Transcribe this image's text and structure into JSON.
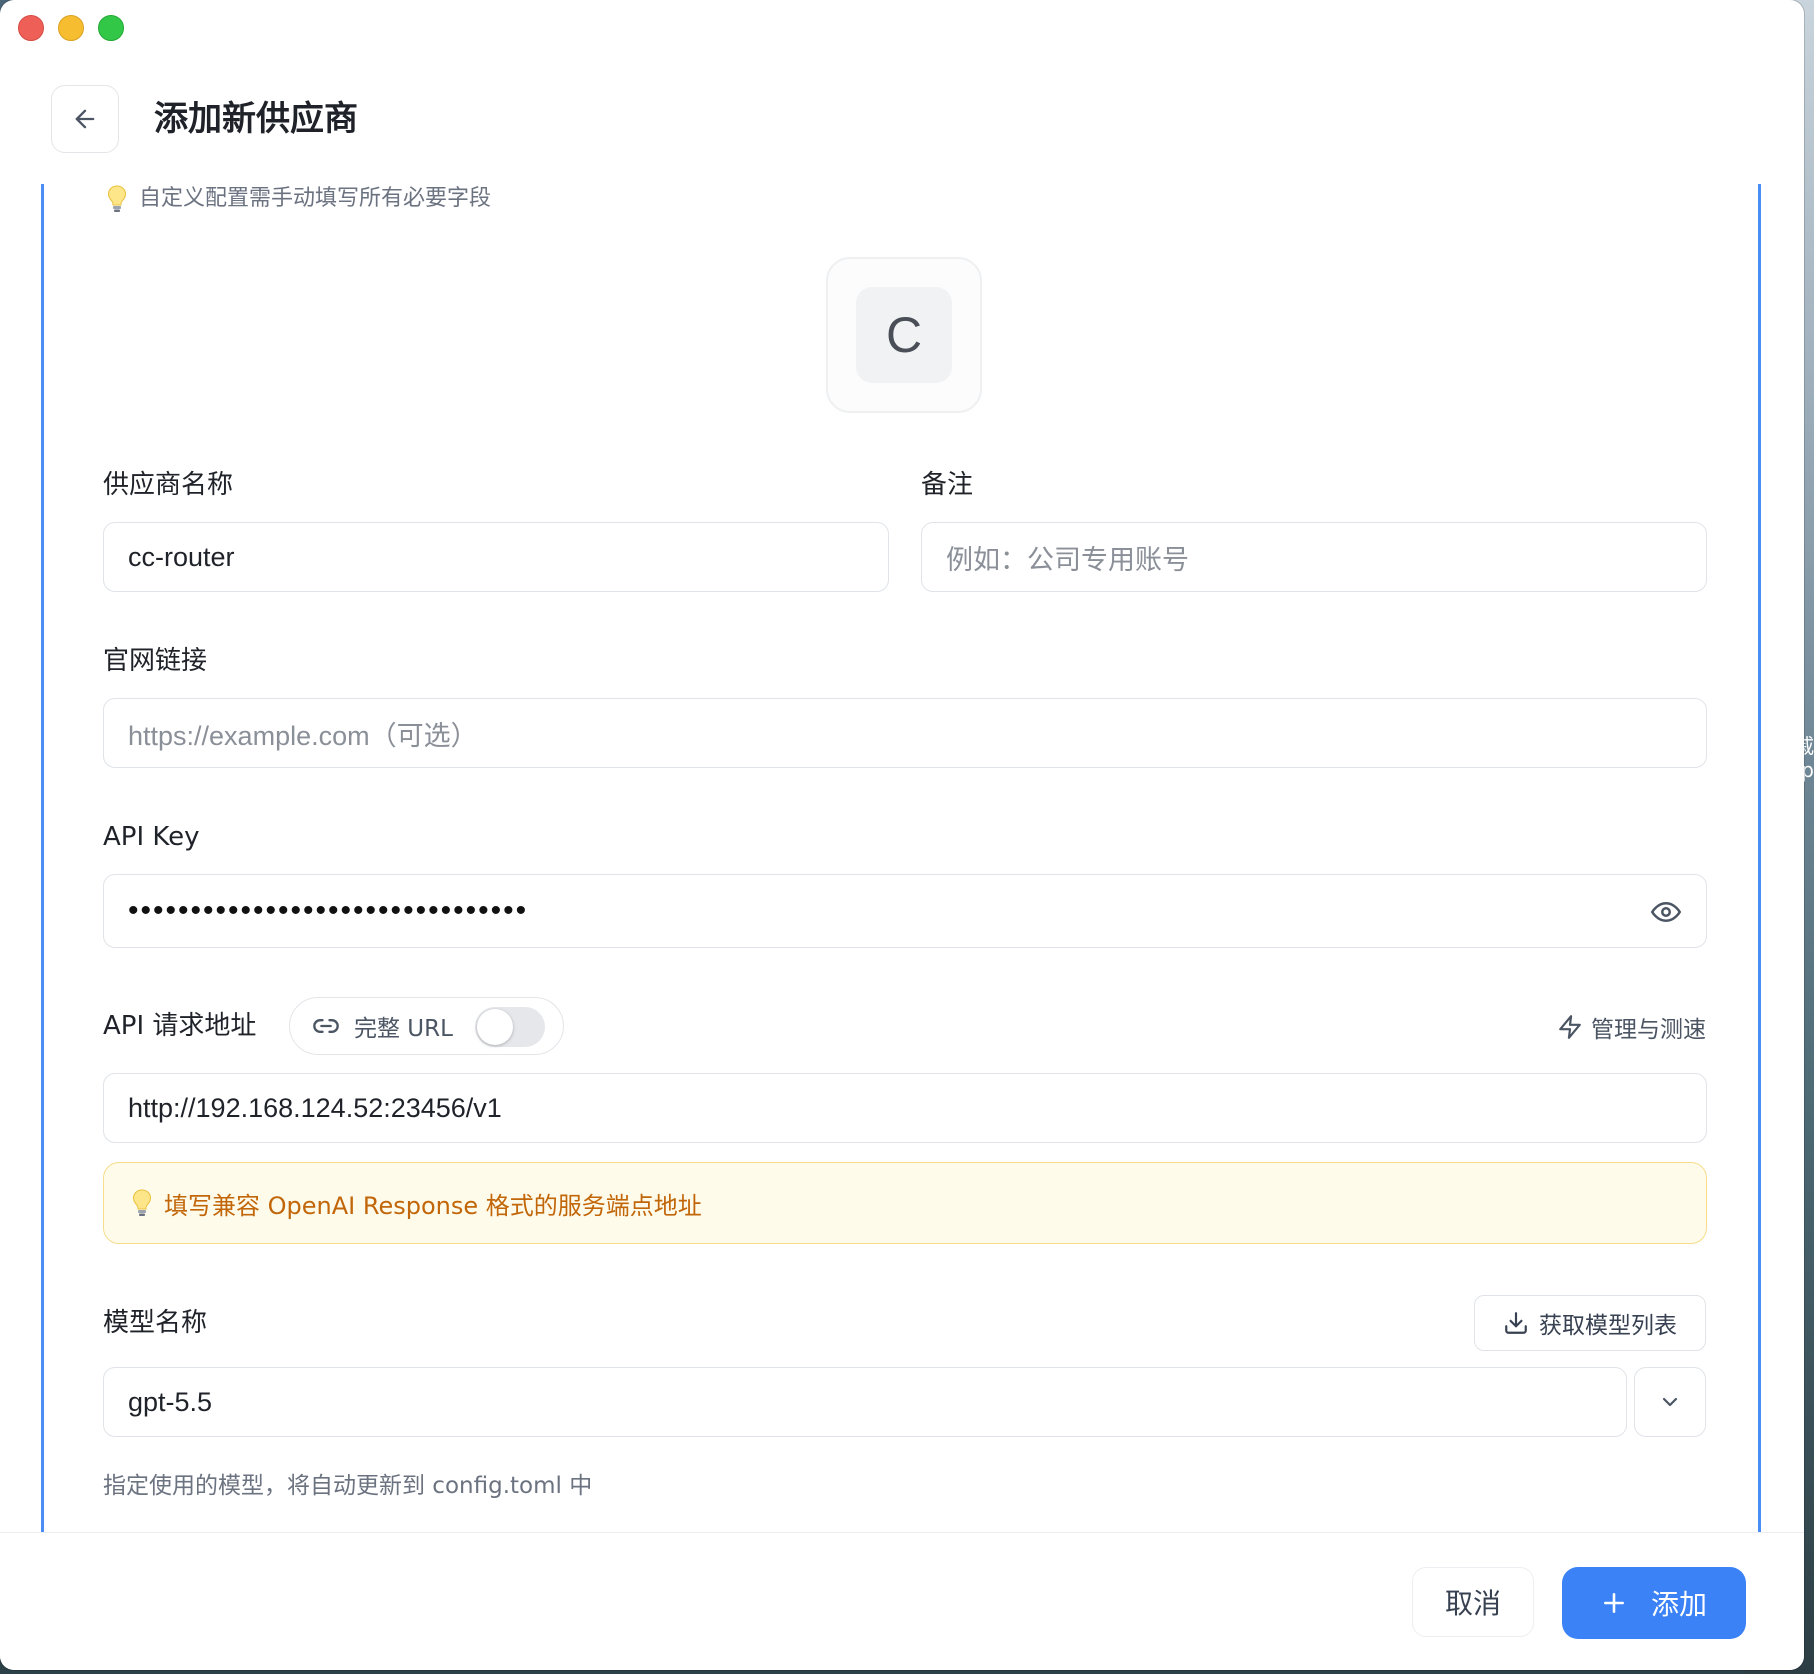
{
  "page": {
    "title": "添加新供应商",
    "hint_top": "自定义配置需手动填写所有必要字段",
    "avatar_letter": "C"
  },
  "form": {
    "provider_name": {
      "label": "供应商名称",
      "value": "cc-router"
    },
    "notes": {
      "label": "备注",
      "placeholder": "例如：公司专用账号"
    },
    "website": {
      "label": "官网链接",
      "placeholder": "https://example.com（可选）"
    },
    "api_key": {
      "label": "API Key",
      "masked_value": "••••••••••••••••••••••••••••••••"
    },
    "api_endpoint": {
      "label": "API 请求地址",
      "full_url_label": "完整 URL",
      "full_url_enabled": false,
      "manage_label": "管理与测速",
      "value": "http://192.168.124.52:23456/v1",
      "warning": "填写兼容 OpenAI Response 格式的服务端点地址"
    },
    "model": {
      "label": "模型名称",
      "fetch_label": "获取模型列表",
      "value": "gpt-5.5",
      "helper": "指定使用的模型，将自动更新到 config.toml 中"
    }
  },
  "footer": {
    "cancel_label": "取消",
    "add_label": "添加"
  },
  "icons": {
    "back": "arrow-left-icon",
    "bulb": "lightbulb-icon",
    "eye": "eye-icon",
    "link": "link-icon",
    "zap": "zap-icon",
    "download": "download-icon",
    "chevron": "chevron-down-icon",
    "plus": "plus-icon"
  },
  "colors": {
    "accent": "#3b82f6",
    "warning_text": "#c2660a",
    "warning_bg": "#fffbea"
  },
  "desktop": {
    "glyph_1": "戚",
    "glyph_2": "p"
  }
}
